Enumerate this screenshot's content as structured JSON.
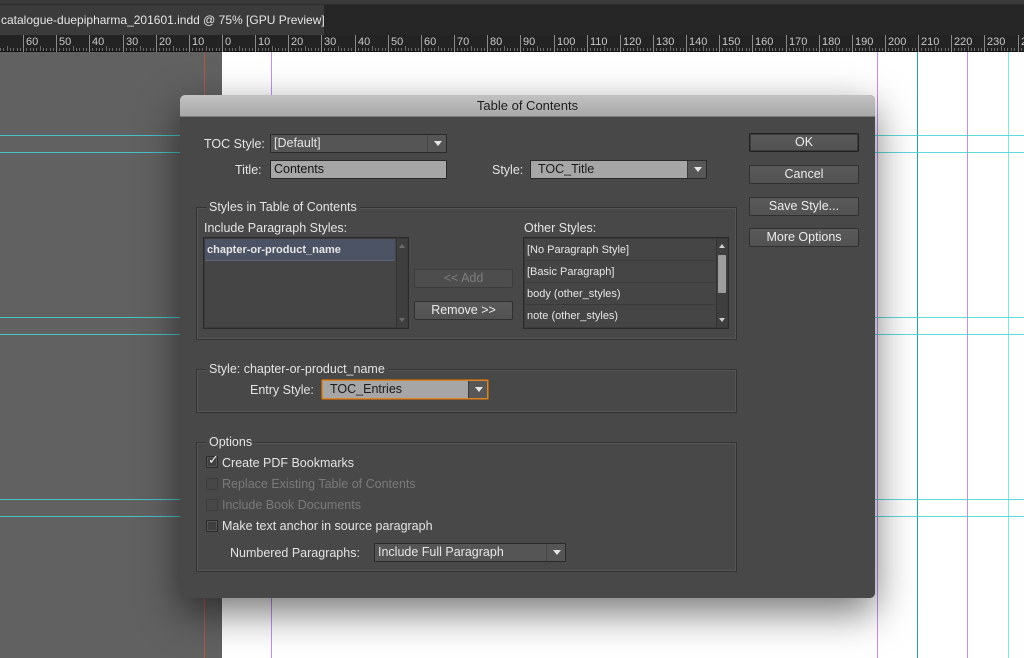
{
  "window": {
    "document_tab_title": "catalogue-duepipharma_201601.indd @ 75% [GPU Preview]"
  },
  "ruler": {
    "labels": [
      "0",
      "60",
      "50",
      "40",
      "30",
      "20",
      "10",
      "0",
      "10",
      "20",
      "30",
      "40",
      "50",
      "60",
      "70",
      "80",
      "90",
      "100",
      "110",
      "120",
      "130",
      "140",
      "150",
      "160",
      "170",
      "180",
      "190",
      "200",
      "210",
      "220",
      "230",
      "2"
    ]
  },
  "dialog": {
    "title": "Table of Contents",
    "toc_style_label": "TOC Style:",
    "toc_style_value": "[Default]",
    "title_label": "Title:",
    "title_value": "Contents",
    "style_label": "Style:",
    "style_value": "TOC_Title",
    "buttons": {
      "ok": "OK",
      "cancel": "Cancel",
      "save_style": "Save Style...",
      "more_options": "More Options"
    },
    "styles_group": {
      "title": "Styles in Table of Contents",
      "include_label": "Include Paragraph Styles:",
      "include_items": [
        "chapter-or-product_name"
      ],
      "selected_include": "chapter-or-product_name",
      "add_button": "<< Add",
      "remove_button": "Remove >>",
      "other_label": "Other Styles:",
      "other_items": [
        "[No Paragraph Style]",
        "[Basic Paragraph]",
        "body (other_styles)",
        "note (other_styles)"
      ]
    },
    "style_group": {
      "title": "Style: chapter-or-product_name",
      "entry_style_label": "Entry Style:",
      "entry_style_value": "TOC_Entries"
    },
    "options_group": {
      "title": "Options",
      "checkboxes": [
        {
          "label": "Create PDF Bookmarks",
          "checked": true,
          "enabled": true
        },
        {
          "label": "Replace Existing Table of Contents",
          "checked": false,
          "enabled": false
        },
        {
          "label": "Include Book Documents",
          "checked": false,
          "enabled": false
        },
        {
          "label": "Make text anchor in source paragraph",
          "checked": false,
          "enabled": true
        }
      ],
      "numbered_label": "Numbered Paragraphs:",
      "numbered_value": "Include Full Paragraph"
    }
  },
  "colors": {
    "guide_cyan": "#3fd3d7",
    "guide_purple": "#c78cf0",
    "bleed_red": "#c0574b",
    "focus_orange": "#d7852f",
    "selection_row": "#4b5364"
  }
}
